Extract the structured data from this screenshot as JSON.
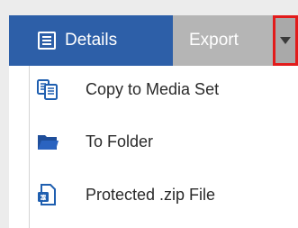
{
  "toolbar": {
    "details_label": "Details",
    "export_label": "Export",
    "details_icon": "details-list-icon",
    "dropdown_icon": "chevron-down-icon",
    "colors": {
      "bar": "#2d5fa8",
      "export_bg": "#b5b5b5",
      "highlight": "#e21b1b"
    }
  },
  "menu": {
    "items": [
      {
        "label": "Copy to Media Set",
        "icon": "copy-icon"
      },
      {
        "label": "To Folder",
        "icon": "folder-icon"
      },
      {
        "label": "Protected .zip File",
        "icon": "zip-file-icon"
      }
    ]
  }
}
